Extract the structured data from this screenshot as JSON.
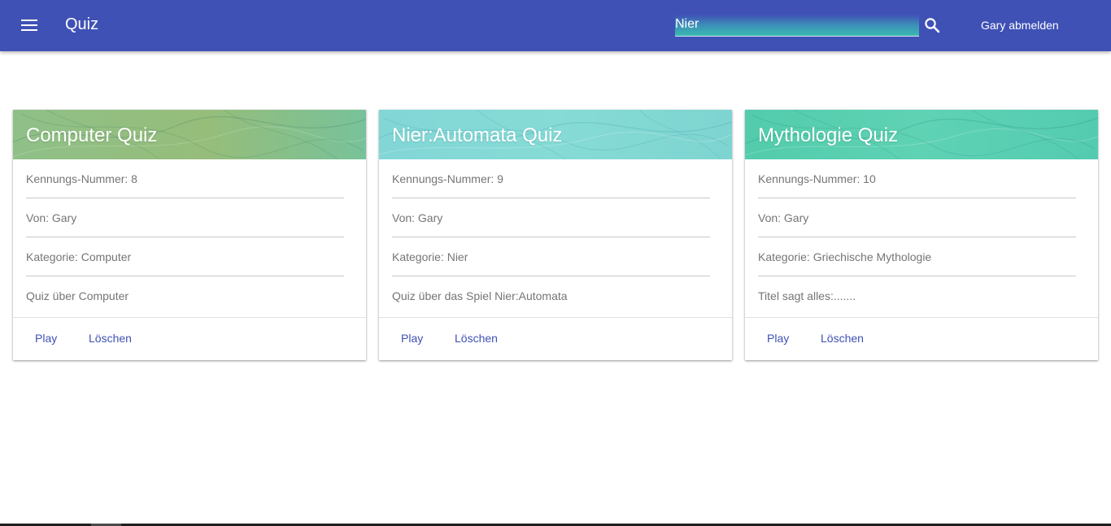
{
  "appbar": {
    "menu_icon": "menu-icon",
    "title": "Quiz",
    "search": {
      "value": "Nier",
      "icon": "search-icon"
    },
    "logout": "Gary abmelden",
    "color": "#3f51b5"
  },
  "cards": [
    {
      "title": "Computer Quiz",
      "id_line": "Kennungs-Nummer: 8",
      "author": "Von: Gary",
      "category": "Kategorie: Computer",
      "description": "Quiz über Computer",
      "play": "Play",
      "delete": "Löschen",
      "header_color": "#8fbe7e"
    },
    {
      "title": "Nier:Automata Quiz",
      "id_line": "Kennungs-Nummer: 9",
      "author": "Von: Gary",
      "category": "Kategorie: Nier",
      "description": "Quiz über das Spiel Nier:Automata",
      "play": "Play",
      "delete": "Löschen",
      "header_color": "#7fd8d2"
    },
    {
      "title": "Mythologie Quiz",
      "id_line": "Kennungs-Nummer: 10",
      "author": "Von: Gary",
      "category": "Kategorie: Griechische Mythologie",
      "description": "Titel sagt alles:.......",
      "play": "Play",
      "delete": "Löschen",
      "header_color": "#55cfae"
    }
  ]
}
